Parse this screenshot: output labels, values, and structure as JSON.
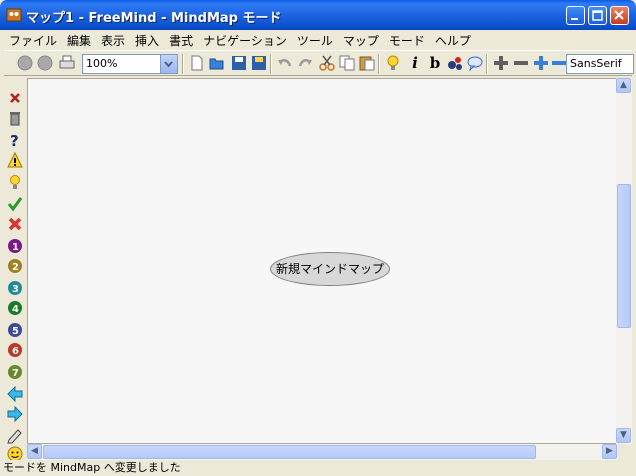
{
  "window": {
    "title": "マップ1 - FreeMind - MindMap モード"
  },
  "menubar": {
    "items": [
      "ファイル",
      "編集",
      "表示",
      "挿入",
      "書式",
      "ナビゲーション",
      "ツール",
      "マップ",
      "モード",
      "ヘルプ"
    ]
  },
  "toolbar": {
    "zoom_value": "100%",
    "font_value": "SansSerif",
    "italic_label": "i",
    "bold_label": "b"
  },
  "side_icons": [
    "delete-icon",
    "trash-icon",
    "question-icon",
    "warning-icon",
    "idea-icon",
    "check-icon",
    "cross-icon",
    "priority-1-icon",
    "priority-2-icon",
    "priority-3-icon",
    "priority-4-icon",
    "priority-5-icon",
    "priority-6-icon",
    "priority-7-icon",
    "arrow-left-icon",
    "arrow-right-icon",
    "pencil-icon",
    "smiley-icon"
  ],
  "map": {
    "root_node_text": "新規マインドマップ"
  },
  "statusbar": {
    "text": "モードを MindMap へ変更しました"
  },
  "colors": {
    "title_bar": "#0a5ae6",
    "canvas": "#f7f7f7",
    "root_fill": "#d8d8d8"
  }
}
